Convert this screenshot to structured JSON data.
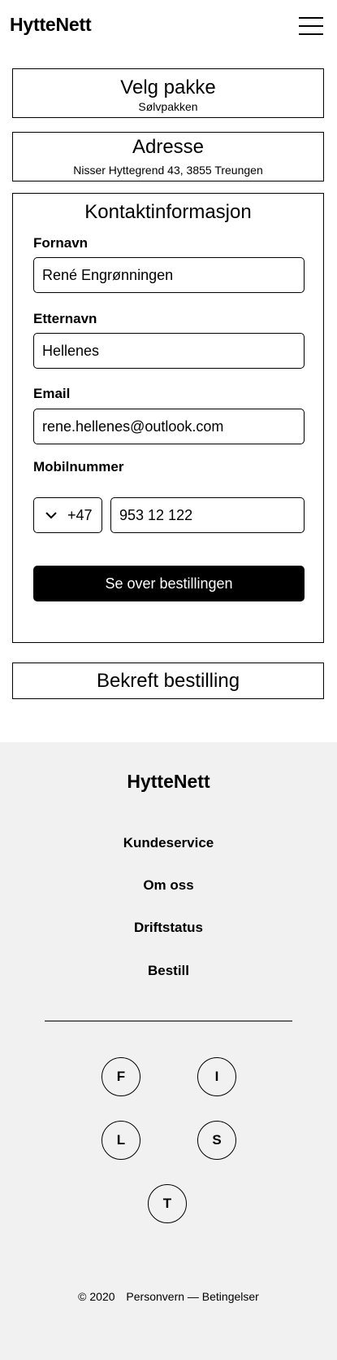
{
  "header": {
    "logo": "HytteNett",
    "menu_icon": "hamburger-menu-icon"
  },
  "steps": {
    "package": {
      "title": "Velg pakke",
      "value": "Sølvpakken"
    },
    "address": {
      "title": "Adresse",
      "value": "Nisser Hyttegrend 43, 3855 Treungen"
    },
    "contact": {
      "title": "Kontaktinformasjon",
      "first_name": {
        "label": "Fornavn",
        "value": "René Engrønningen"
      },
      "last_name": {
        "label": "Etternavn",
        "value": "Hellenes"
      },
      "email": {
        "label": "Email",
        "value": "rene.hellenes@outlook.com"
      },
      "phone": {
        "label": "Mobilnummer",
        "country_code": "+47",
        "value": "953 12 122",
        "dropdown_icon": "chevron-down-icon"
      },
      "review_button": "Se over bestillingen"
    },
    "confirm": {
      "title": "Bekreft bestilling"
    }
  },
  "footer": {
    "logo": "HytteNett",
    "links": [
      "Kundeservice",
      "Om oss",
      "Driftstatus",
      "Bestill"
    ],
    "social": [
      "F",
      "I",
      "L",
      "S",
      "T"
    ],
    "copyright": {
      "symbol": "©",
      "year": "2020",
      "text": "Personvern — Betingelser"
    }
  }
}
